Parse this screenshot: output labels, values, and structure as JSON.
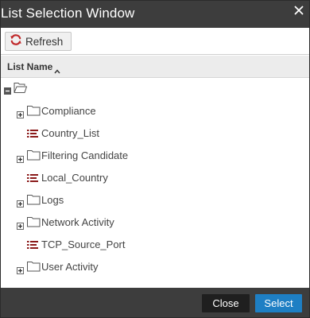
{
  "window": {
    "title": "List Selection Window"
  },
  "toolbar": {
    "refresh_label": "Refresh"
  },
  "column": {
    "header": "List Name",
    "sort": "ascending"
  },
  "tree": {
    "root": {
      "expanded": true,
      "icon": "folder-open-icon"
    },
    "items": [
      {
        "label": "Compliance",
        "type": "folder",
        "expandable": true
      },
      {
        "label": "Country_List",
        "type": "list",
        "expandable": false
      },
      {
        "label": "Filtering Candidate",
        "type": "folder",
        "expandable": true
      },
      {
        "label": "Local_Country",
        "type": "list",
        "expandable": false
      },
      {
        "label": "Logs",
        "type": "folder",
        "expandable": true
      },
      {
        "label": "Network Activity",
        "type": "folder",
        "expandable": true
      },
      {
        "label": "TCP_Source_Port",
        "type": "list",
        "expandable": false
      },
      {
        "label": "User Activity",
        "type": "folder",
        "expandable": true
      }
    ]
  },
  "footer": {
    "close_label": "Close",
    "select_label": "Select"
  },
  "colors": {
    "titlebar": "#3d3d3d",
    "accent": "#1e7fc4",
    "list_icon": "#8b1a1a",
    "refresh_icon": "#c0282a"
  }
}
